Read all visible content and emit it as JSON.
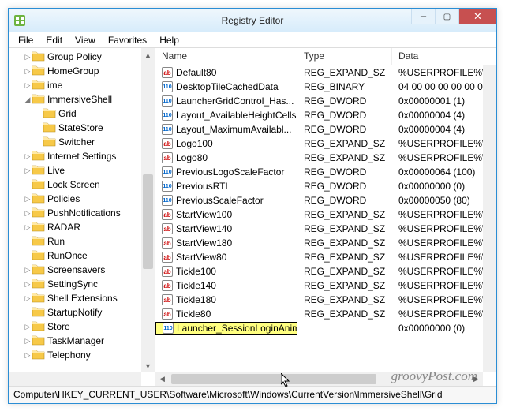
{
  "window": {
    "title": "Registry Editor"
  },
  "menu": [
    "File",
    "Edit",
    "View",
    "Favorites",
    "Help"
  ],
  "columns": {
    "name": "Name",
    "type": "Type",
    "data": "Data"
  },
  "tree": [
    {
      "depth": 1,
      "exp": "closed",
      "label": "Group Policy"
    },
    {
      "depth": 1,
      "exp": "closed",
      "label": "HomeGroup"
    },
    {
      "depth": 1,
      "exp": "closed",
      "label": "ime"
    },
    {
      "depth": 1,
      "exp": "open",
      "label": "ImmersiveShell"
    },
    {
      "depth": 2,
      "exp": "none",
      "label": "Grid",
      "selected": true
    },
    {
      "depth": 2,
      "exp": "none",
      "label": "StateStore"
    },
    {
      "depth": 2,
      "exp": "none",
      "label": "Switcher"
    },
    {
      "depth": 1,
      "exp": "closed",
      "label": "Internet Settings"
    },
    {
      "depth": 1,
      "exp": "closed",
      "label": "Live"
    },
    {
      "depth": 1,
      "exp": "none",
      "label": "Lock Screen"
    },
    {
      "depth": 1,
      "exp": "closed",
      "label": "Policies"
    },
    {
      "depth": 1,
      "exp": "closed",
      "label": "PushNotifications"
    },
    {
      "depth": 1,
      "exp": "closed",
      "label": "RADAR"
    },
    {
      "depth": 1,
      "exp": "none",
      "label": "Run"
    },
    {
      "depth": 1,
      "exp": "none",
      "label": "RunOnce"
    },
    {
      "depth": 1,
      "exp": "closed",
      "label": "Screensavers"
    },
    {
      "depth": 1,
      "exp": "closed",
      "label": "SettingSync"
    },
    {
      "depth": 1,
      "exp": "closed",
      "label": "Shell Extensions"
    },
    {
      "depth": 1,
      "exp": "none",
      "label": "StartupNotify"
    },
    {
      "depth": 1,
      "exp": "closed",
      "label": "Store"
    },
    {
      "depth": 1,
      "exp": "closed",
      "label": "TaskManager"
    },
    {
      "depth": 1,
      "exp": "closed",
      "label": "Telephony"
    }
  ],
  "values": [
    {
      "icon": "str",
      "name": "Default80",
      "type": "REG_EXPAND_SZ",
      "data": "%USERPROFILE%\\"
    },
    {
      "icon": "bin",
      "name": "DesktopTileCachedData",
      "type": "REG_BINARY",
      "data": "04 00 00 00 00 00 0"
    },
    {
      "icon": "bin",
      "name": "LauncherGridControl_Has...",
      "type": "REG_DWORD",
      "data": "0x00000001 (1)"
    },
    {
      "icon": "bin",
      "name": "Layout_AvailableHeightCells",
      "type": "REG_DWORD",
      "data": "0x00000004 (4)"
    },
    {
      "icon": "bin",
      "name": "Layout_MaximumAvailabl...",
      "type": "REG_DWORD",
      "data": "0x00000004 (4)"
    },
    {
      "icon": "str",
      "name": "Logo100",
      "type": "REG_EXPAND_SZ",
      "data": "%USERPROFILE%\\"
    },
    {
      "icon": "str",
      "name": "Logo80",
      "type": "REG_EXPAND_SZ",
      "data": "%USERPROFILE%\\"
    },
    {
      "icon": "bin",
      "name": "PreviousLogoScaleFactor",
      "type": "REG_DWORD",
      "data": "0x00000064 (100)"
    },
    {
      "icon": "bin",
      "name": "PreviousRTL",
      "type": "REG_DWORD",
      "data": "0x00000000 (0)"
    },
    {
      "icon": "bin",
      "name": "PreviousScaleFactor",
      "type": "REG_DWORD",
      "data": "0x00000050 (80)"
    },
    {
      "icon": "str",
      "name": "StartView100",
      "type": "REG_EXPAND_SZ",
      "data": "%USERPROFILE%\\"
    },
    {
      "icon": "str",
      "name": "StartView140",
      "type": "REG_EXPAND_SZ",
      "data": "%USERPROFILE%\\"
    },
    {
      "icon": "str",
      "name": "StartView180",
      "type": "REG_EXPAND_SZ",
      "data": "%USERPROFILE%\\"
    },
    {
      "icon": "str",
      "name": "StartView80",
      "type": "REG_EXPAND_SZ",
      "data": "%USERPROFILE%\\"
    },
    {
      "icon": "str",
      "name": "Tickle100",
      "type": "REG_EXPAND_SZ",
      "data": "%USERPROFILE%\\"
    },
    {
      "icon": "str",
      "name": "Tickle140",
      "type": "REG_EXPAND_SZ",
      "data": "%USERPROFILE%\\"
    },
    {
      "icon": "str",
      "name": "Tickle180",
      "type": "REG_EXPAND_SZ",
      "data": "%USERPROFILE%\\"
    },
    {
      "icon": "str",
      "name": "Tickle80",
      "type": "REG_EXPAND_SZ",
      "data": "%USERPROFILE%\\"
    },
    {
      "icon": "bin",
      "name": "Launcher_SessionLoginAnimation_OnShow",
      "type": "",
      "data": "0x00000000 (0)",
      "highlight": true
    }
  ],
  "status": "Computer\\HKEY_CURRENT_USER\\Software\\Microsoft\\Windows\\CurrentVersion\\ImmersiveShell\\Grid",
  "watermark": "groovyPost.com"
}
